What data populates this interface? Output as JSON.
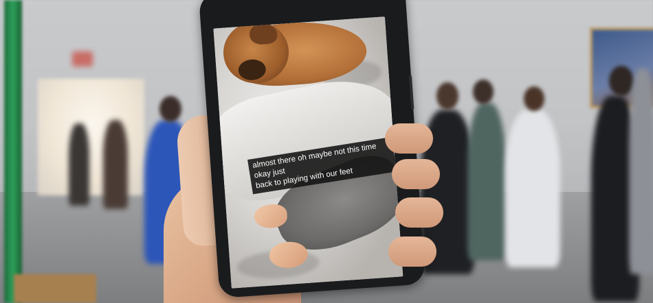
{
  "caption": {
    "line1": "almost there oh maybe not this time okay just",
    "line2": "back to playing with our feet"
  },
  "colors": {
    "caption_background": "#121212",
    "caption_text": "#ffffff",
    "phone_body": "#1a1b1d"
  }
}
